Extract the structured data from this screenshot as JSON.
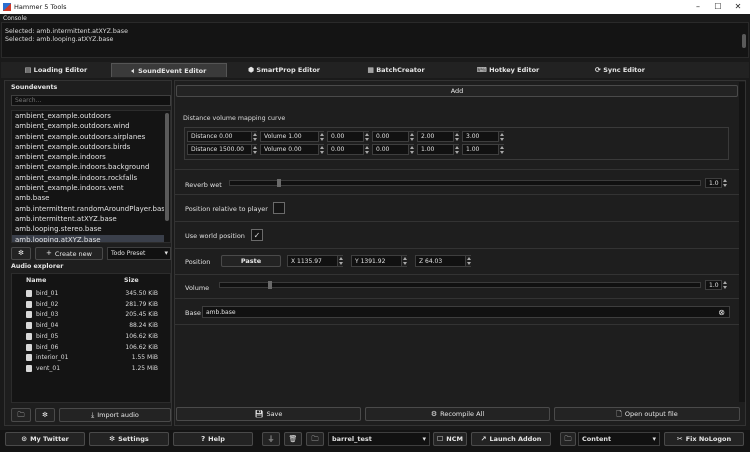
{
  "window": {
    "title": "Hammer 5 Tools",
    "controls": [
      "–",
      "☐",
      "✕"
    ]
  },
  "console": {
    "label": "Console",
    "lines": [
      "Selected: amb.intermittent.atXYZ.base",
      "Selected: amb.looping.atXYZ.base"
    ]
  },
  "tabs": [
    {
      "label": "Loading Editor",
      "icon": "list-icon"
    },
    {
      "label": "SoundEvent Editor",
      "icon": "speaker-icon",
      "active": true
    },
    {
      "label": "SmartProp Editor",
      "icon": "cube-icon"
    },
    {
      "label": "BatchCreator",
      "icon": "grid-icon"
    },
    {
      "label": "Hotkey Editor",
      "icon": "keyboard-icon"
    },
    {
      "label": "Sync Editor",
      "icon": "sync-icon"
    }
  ],
  "soundevents": {
    "label": "Soundevents",
    "search_placeholder": "Search...",
    "items": [
      "ambient_example.outdoors",
      "ambient_example.outdoors.wind",
      "ambient_example.outdoors.airplanes",
      "ambient_example.outdoors.birds",
      "ambient_example.indoors",
      "ambient_example.indoors.background",
      "ambient_example.indoors.rockfalls",
      "ambient_example.indoors.vent",
      "amb.base",
      "amb.intermittent.randomAroundPlayer.base",
      "amb.intermittent.atXYZ.base",
      "amb.looping.stereo.base",
      "amb.looping.atXYZ.base"
    ],
    "selected_index": 12,
    "create_label": "Create new",
    "preset": "Todo Preset"
  },
  "audio_explorer": {
    "label": "Audio explorer",
    "columns": [
      "Name",
      "Size"
    ],
    "rows": [
      {
        "name": "bird_01",
        "size": "345.50 KiB"
      },
      {
        "name": "bird_02",
        "size": "281.79 KiB"
      },
      {
        "name": "bird_03",
        "size": "205.45 KiB"
      },
      {
        "name": "bird_04",
        "size": "88.24 KiB"
      },
      {
        "name": "bird_05",
        "size": "106.62 KiB"
      },
      {
        "name": "bird_06",
        "size": "106.62 KiB"
      },
      {
        "name": "interior_01",
        "size": "1.55 MiB"
      },
      {
        "name": "vent_01",
        "size": "1.25 MiB"
      }
    ],
    "import_label": "Import audio"
  },
  "editor": {
    "add_label": "Add",
    "curve_label": "Distance volume mapping curve",
    "curve_rows": [
      [
        "Distance  0.00",
        "Volume 1.00",
        "0.00",
        "0.00",
        "2.00",
        "3.00"
      ],
      [
        "Distance  1500.00",
        "Volume 0.00",
        "0.00",
        "0.00",
        "1.00",
        "1.00"
      ]
    ],
    "reverb_label": "Reverb wet",
    "reverb_value": "1.0",
    "reverb_fraction": 0.1,
    "position_relative_label": "Position relative to player",
    "world_position_label": "Use world position",
    "world_position_check": "✓",
    "position_label": "Position",
    "paste_label": "Paste",
    "pos_x": "X 1135.97",
    "pos_y": "Y 1391.92",
    "pos_z": "Z 64.03",
    "volume_label": "Volume",
    "volume_value": "1.0",
    "volume_fraction": 0.1,
    "base_label": "Base",
    "base_value": "amb.base",
    "save_label": "Save",
    "recompile_label": "Recompile All",
    "open_output_label": "Open output file"
  },
  "bottom": {
    "twitter": "My Twitter",
    "settings": "Settings",
    "help": "Help",
    "addon": "barrel_test",
    "ncm": "NCM",
    "launch": "Launch Addon",
    "content": "Content",
    "fix": "Fix NoLogon"
  }
}
